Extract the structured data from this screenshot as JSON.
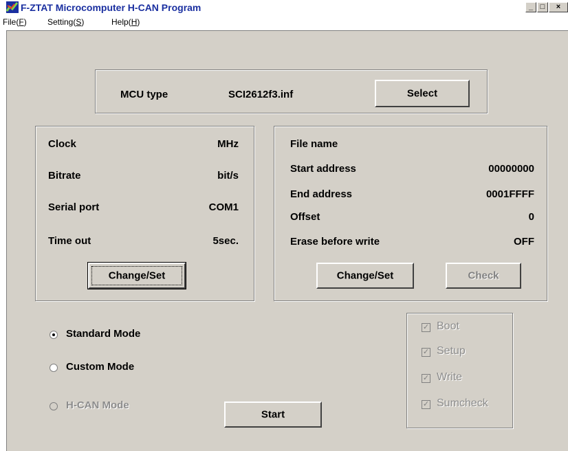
{
  "window": {
    "title": "F-ZTAT Microcomputer H-CAN Program",
    "minimize_glyph": "_",
    "maximize_glyph": "□",
    "close_glyph": "×"
  },
  "menu": [
    {
      "label": "File(",
      "key": "F",
      "end": ")"
    },
    {
      "label": "Setting(",
      "key": "S",
      "end": ")"
    },
    {
      "label": "Help(",
      "key": "H",
      "end": ")"
    }
  ],
  "mcu": {
    "label": "MCU type",
    "value": "SCI2612f3.inf",
    "select_button": "Select"
  },
  "comm": {
    "rows": [
      {
        "label": "Clock",
        "value": "MHz"
      },
      {
        "label": "Bitrate",
        "value": "bit/s"
      },
      {
        "label": "Serial port",
        "value": "COM1"
      },
      {
        "label": "Time out",
        "value": "5sec."
      }
    ],
    "change_button": "Change/Set"
  },
  "file": {
    "rows": [
      {
        "label": "File name",
        "value": ""
      },
      {
        "label": "Start address",
        "value": "00000000"
      },
      {
        "label": "End address",
        "value": "0001FFFF"
      },
      {
        "label": "Offset",
        "value": "0"
      },
      {
        "label": "Erase before write",
        "value": "OFF"
      }
    ],
    "change_button": "Change/Set",
    "check_button": "Check"
  },
  "modes": [
    {
      "label": "Standard Mode",
      "selected": true,
      "enabled": true
    },
    {
      "label": "Custom Mode",
      "selected": false,
      "enabled": true
    },
    {
      "label": "H-CAN Mode",
      "selected": false,
      "enabled": false
    }
  ],
  "start_button": "Start",
  "steps": [
    {
      "label": "Boot",
      "checked": true
    },
    {
      "label": "Setup",
      "checked": true
    },
    {
      "label": "Write",
      "checked": true
    },
    {
      "label": "Sumcheck",
      "checked": true
    }
  ],
  "colors": {
    "face": "#d4d0c8",
    "title_text": "#1a2fa0",
    "disabled": "#8c8c8c"
  }
}
